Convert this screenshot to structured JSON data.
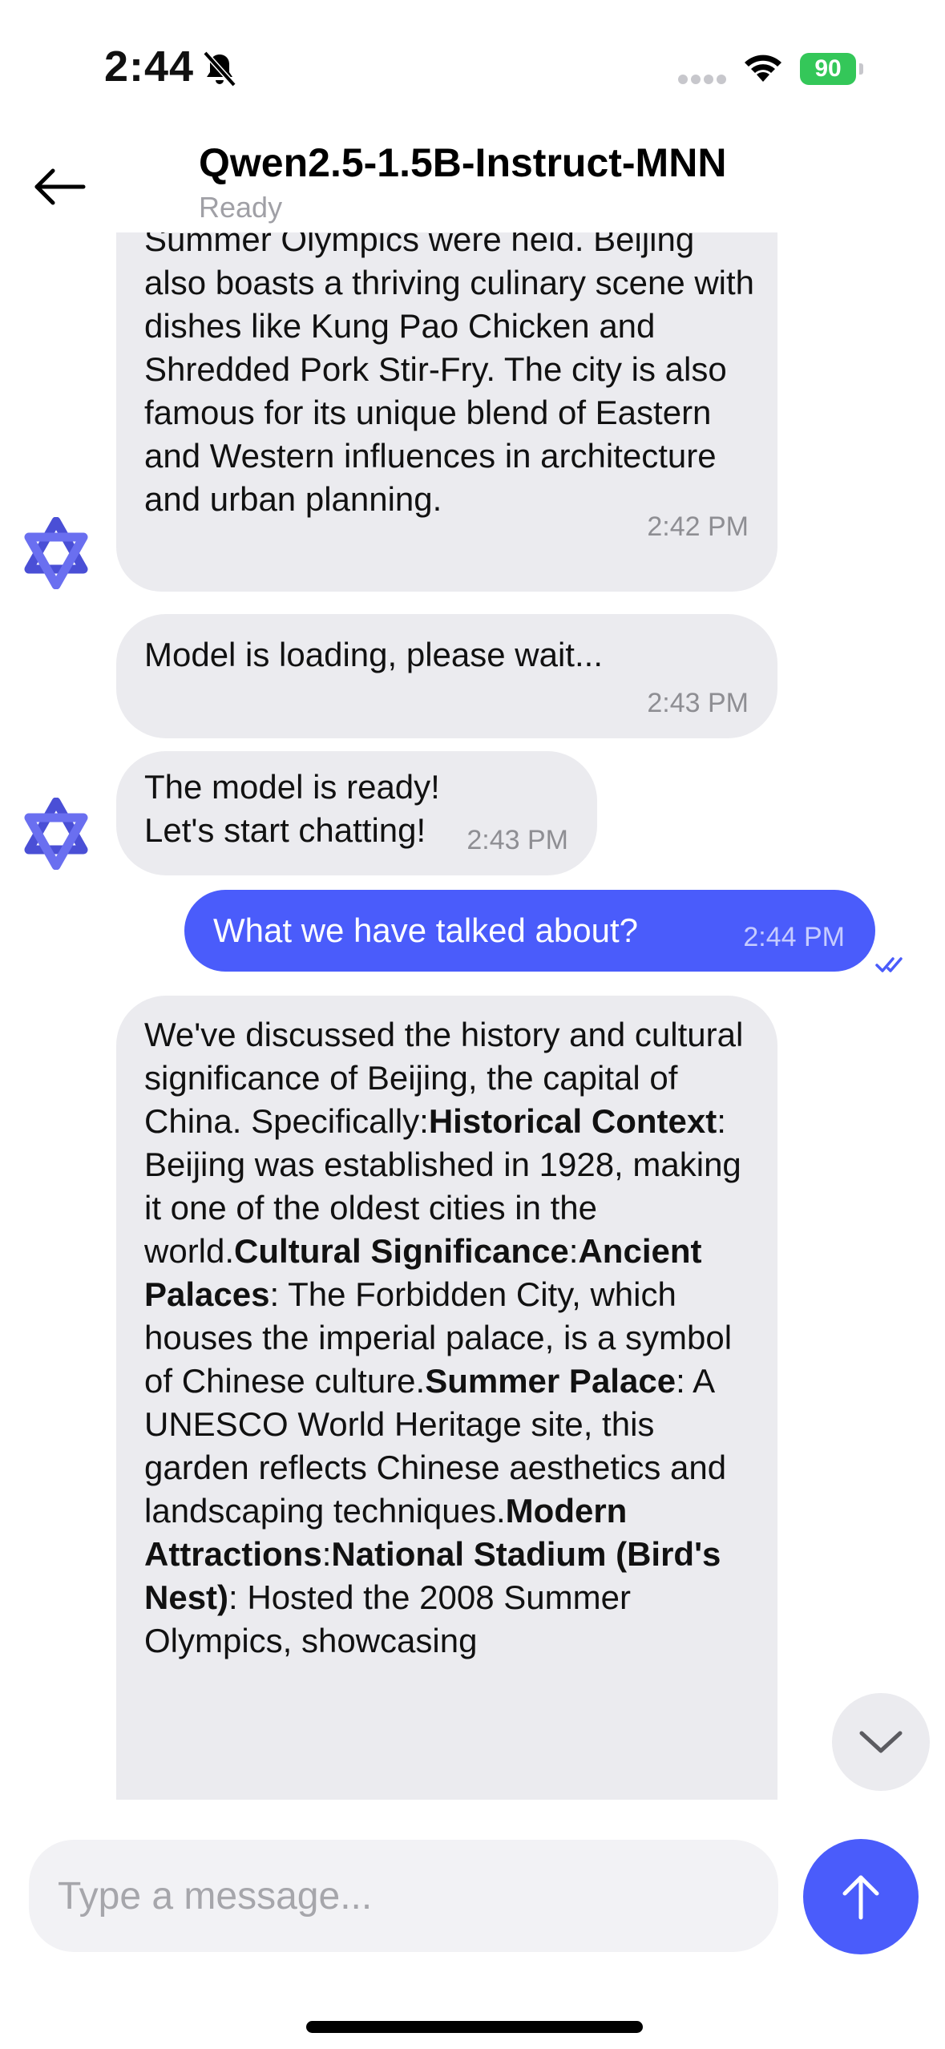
{
  "status_bar": {
    "time": "2:44",
    "battery_level": "90"
  },
  "header": {
    "title": "Qwen2.5-1.5B-Instruct-MNN",
    "subtitle": "Ready"
  },
  "messages": [
    {
      "sender": "bot",
      "segments": [
        {
          "text": "Summer Olympics were held. Beijing also boasts a thriving culinary scene with dishes like Kung Pao Chicken and Shredded Pork Stir-Fry. The city is also famous for its unique blend of Eastern and Western influences in architecture and urban planning.",
          "bold": false
        }
      ],
      "time": "2:42 PM"
    },
    {
      "sender": "bot",
      "segments": [
        {
          "text": "Model is loading, please wait...",
          "bold": false
        }
      ],
      "time": "2:43 PM"
    },
    {
      "sender": "bot",
      "segments": [
        {
          "text": "The model is ready! Let's start chatting!",
          "bold": false
        }
      ],
      "time": "2:43 PM"
    },
    {
      "sender": "user",
      "segments": [
        {
          "text": "What we have talked about?",
          "bold": false
        }
      ],
      "time": "2:44 PM"
    },
    {
      "sender": "bot",
      "segments": [
        {
          "text": "We've discussed the history and cultural significance of Beijing, the capital of China. Specifically:",
          "bold": false
        },
        {
          "text": "Historical Context",
          "bold": true
        },
        {
          "text": ": Beijing was established in 1928, making it one of the oldest cities in the world.",
          "bold": false
        },
        {
          "text": "Cultural Significance",
          "bold": true
        },
        {
          "text": ":",
          "bold": false
        },
        {
          "text": "Ancient Palaces",
          "bold": true
        },
        {
          "text": ": The Forbidden City, which houses the imperial palace, is a symbol of Chinese culture.",
          "bold": false
        },
        {
          "text": "Summer Palace",
          "bold": true
        },
        {
          "text": ": A UNESCO World Heritage site, this garden reflects Chinese aesthetics and landscaping techniques.",
          "bold": false
        },
        {
          "text": "Modern Attractions",
          "bold": true
        },
        {
          "text": ":",
          "bold": false
        },
        {
          "text": "National Stadium (Bird's Nest)",
          "bold": true
        },
        {
          "text": ": Hosted the 2008 Summer Olympics, showcasing",
          "bold": false
        }
      ],
      "time": ""
    }
  ],
  "input": {
    "placeholder": "Type a message..."
  },
  "colors": {
    "accent": "#4a5cfb",
    "bot_bubble": "#ebebef",
    "battery": "#34c759"
  },
  "icons": {
    "back": "arrow-left-icon",
    "avatar": "qwen-logo-icon",
    "scroll_down": "chevron-down-icon",
    "send": "arrow-up-icon",
    "read_receipt": "double-check-icon"
  }
}
